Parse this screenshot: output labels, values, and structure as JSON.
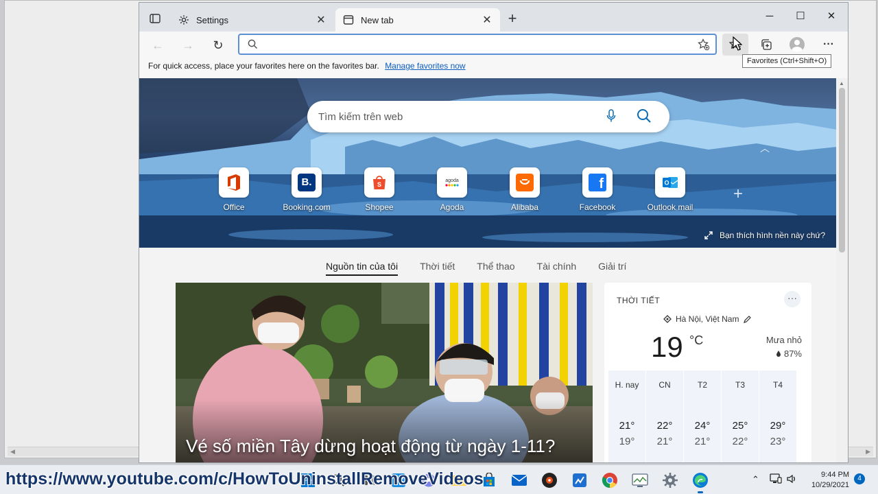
{
  "browser": {
    "tabs": [
      {
        "title": "Settings",
        "icon": "gear-icon",
        "active": false
      },
      {
        "title": "New tab",
        "icon": "newtab-icon",
        "active": true
      }
    ],
    "window_controls": {
      "minimize": "─",
      "maximize": "☐",
      "close": "✕"
    }
  },
  "toolbar": {
    "back": "←",
    "forward": "→",
    "refresh": "↻",
    "address_value": "",
    "more": "···"
  },
  "favorites_bar": {
    "text": "For quick access, place your favorites here on the favorites bar.",
    "link": "Manage favorites now"
  },
  "tooltip": "Favorites (Ctrl+Shift+O)",
  "newtab": {
    "search_placeholder": "Tìm kiếm trên web",
    "tiles": [
      {
        "label": "Office",
        "icon": "office-icon",
        "color": "#d83b01"
      },
      {
        "label": "Booking.com",
        "icon": "booking-icon",
        "color": "#003580"
      },
      {
        "label": "Shopee",
        "icon": "shopee-icon",
        "color": "#ee4d2d"
      },
      {
        "label": "Agoda",
        "icon": "agoda-icon",
        "color": "#5392f9"
      },
      {
        "label": "Alibaba",
        "icon": "alibaba-icon",
        "color": "#ff6a00"
      },
      {
        "label": "Facebook",
        "icon": "facebook-icon",
        "color": "#1877f2"
      },
      {
        "label": "Outlook mail",
        "icon": "outlook-icon",
        "color": "#0078d4"
      }
    ],
    "add_tile": "+",
    "bg_like": "Bạn thích hình nền này chứ?",
    "feed_tabs": [
      "Nguồn tin của tôi",
      "Thời tiết",
      "Thể thao",
      "Tài chính",
      "Giải trí"
    ],
    "news_headline": "Vé số miền Tây dừng hoạt động từ ngày 1-11?"
  },
  "weather": {
    "title": "THỜI TIẾT",
    "more": "···",
    "location": "Hà Nội, Việt Nam",
    "temp": "19",
    "unit": "°C",
    "condition": "Mưa nhỏ",
    "humidity": "87%",
    "forecast": [
      {
        "day": "H. nay",
        "hi": "21°",
        "lo": "19°"
      },
      {
        "day": "CN",
        "hi": "22°",
        "lo": "21°"
      },
      {
        "day": "T2",
        "hi": "24°",
        "lo": "21°"
      },
      {
        "day": "T3",
        "hi": "25°",
        "lo": "22°"
      },
      {
        "day": "T4",
        "hi": "29°",
        "lo": "23°"
      }
    ]
  },
  "taskbar": {
    "time": "9:44 PM",
    "date": "10/29/2021",
    "notifications": "4"
  },
  "watermark": "https://www.youtube.com/c/HowToUninstallRemoveVideos"
}
